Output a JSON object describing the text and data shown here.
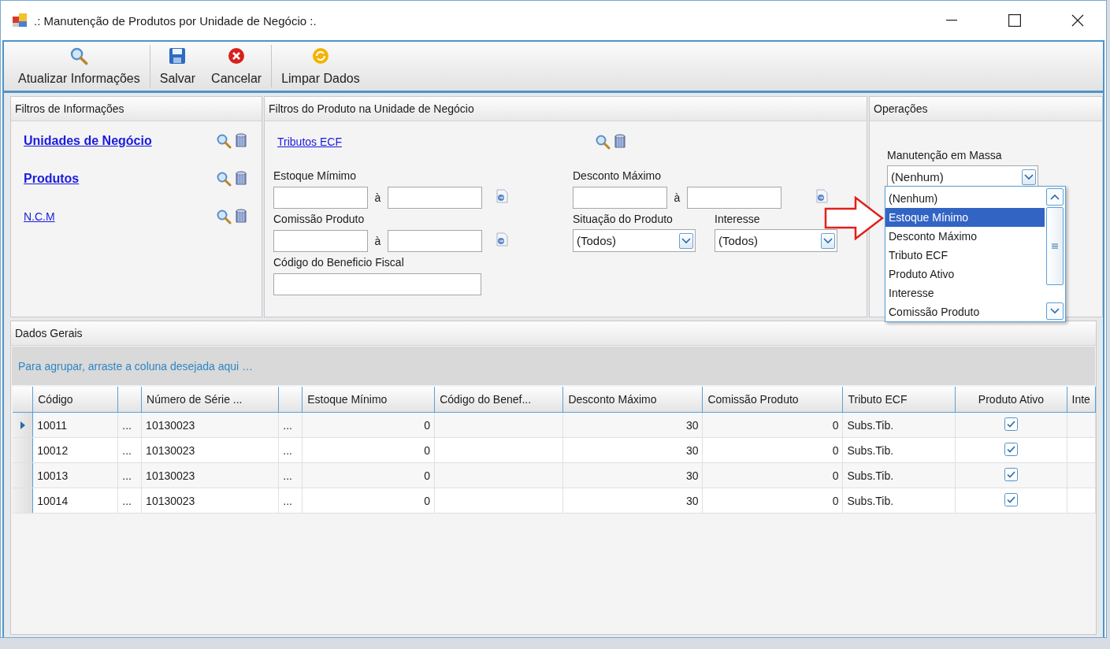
{
  "window": {
    "title": ".: Manutenção de Produtos por Unidade de Negócio :."
  },
  "toolbar": [
    [
      {
        "label": "Atualizar Informações",
        "kind": "search"
      }
    ],
    [
      {
        "label": "Salvar",
        "kind": "save"
      },
      {
        "label": "Cancelar",
        "kind": "cancel"
      }
    ],
    [
      {
        "label": "Limpar Dados",
        "kind": "clear"
      }
    ]
  ],
  "info_filters": {
    "title": "Filtros de Informações",
    "links": [
      {
        "label": "Unidades de Negócio",
        "bold": true
      },
      {
        "label": "Produtos",
        "bold": true
      },
      {
        "label": "N.C.M",
        "bold": false
      }
    ]
  },
  "product_filters": {
    "title": "Filtros do Produto na Unidade de Negócio",
    "link": "Tributos ECF",
    "left": [
      {
        "kind": "range",
        "label": "Estoque Mímimo",
        "joiner": "à"
      },
      {
        "kind": "range",
        "label": "Comissão Produto",
        "joiner": "à"
      },
      {
        "kind": "text",
        "label": "Código do Beneficio Fiscal"
      }
    ],
    "right": [
      {
        "kind": "range",
        "label": "Desconto Máximo",
        "joiner": "à"
      },
      {
        "kind": "selects",
        "selects": [
          {
            "label": "Situação do Produto",
            "value": "(Todos)"
          },
          {
            "label": "Interesse",
            "value": "(Todos)"
          }
        ]
      }
    ]
  },
  "operations": {
    "title": "Operações",
    "mass_label": "Manutenção em Massa",
    "mass_value": "(Nenhum)",
    "options": [
      {
        "label": "(Nenhum)",
        "selected": false
      },
      {
        "label": "Estoque Mínimo",
        "selected": true
      },
      {
        "label": "Desconto Máximo",
        "selected": false
      },
      {
        "label": "Tributo ECF",
        "selected": false
      },
      {
        "label": "Produto Ativo",
        "selected": false
      },
      {
        "label": "Interesse",
        "selected": false
      },
      {
        "label": "Comissão Produto",
        "selected": false
      }
    ]
  },
  "grid": {
    "title": "Dados Gerais",
    "group_hint": "Para agrupar, arraste a coluna desejada aqui …",
    "columns": [
      {
        "label": "Código",
        "kind": "text"
      },
      {
        "kind": "text"
      },
      {
        "label": "Número de Série ...",
        "kind": "text"
      },
      {
        "kind": "text"
      },
      {
        "label": "Estoque Mínimo",
        "kind": "num"
      },
      {
        "label": "Código do Benef...",
        "kind": "blank"
      },
      {
        "label": "Desconto Máximo",
        "kind": "num"
      },
      {
        "label": "Comissão Produto",
        "kind": "num"
      },
      {
        "label": "Tributo ECF",
        "kind": "text"
      },
      {
        "label": "Produto Ativo",
        "kind": "check"
      },
      {
        "label": "Inte",
        "kind": "blank"
      }
    ],
    "rows": [
      {
        "selected": true,
        "cells": [
          "10011",
          "...",
          "10130023",
          "...",
          "0",
          "",
          "30",
          "0",
          "Subs.Tib."
        ],
        "produto_ativo": true
      },
      {
        "selected": false,
        "cells": [
          "10012",
          "...",
          "10130023",
          "...",
          "0",
          "",
          "30",
          "0",
          "Subs.Tib."
        ],
        "produto_ativo": true
      },
      {
        "selected": false,
        "cells": [
          "10013",
          "...",
          "10130023",
          "...",
          "0",
          "",
          "30",
          "0",
          "Subs.Tib."
        ],
        "produto_ativo": true
      },
      {
        "selected": false,
        "cells": [
          "10014",
          "...",
          "10130023",
          "...",
          "0",
          "",
          "30",
          "0",
          "Subs.Tib."
        ],
        "produto_ativo": true
      }
    ]
  }
}
